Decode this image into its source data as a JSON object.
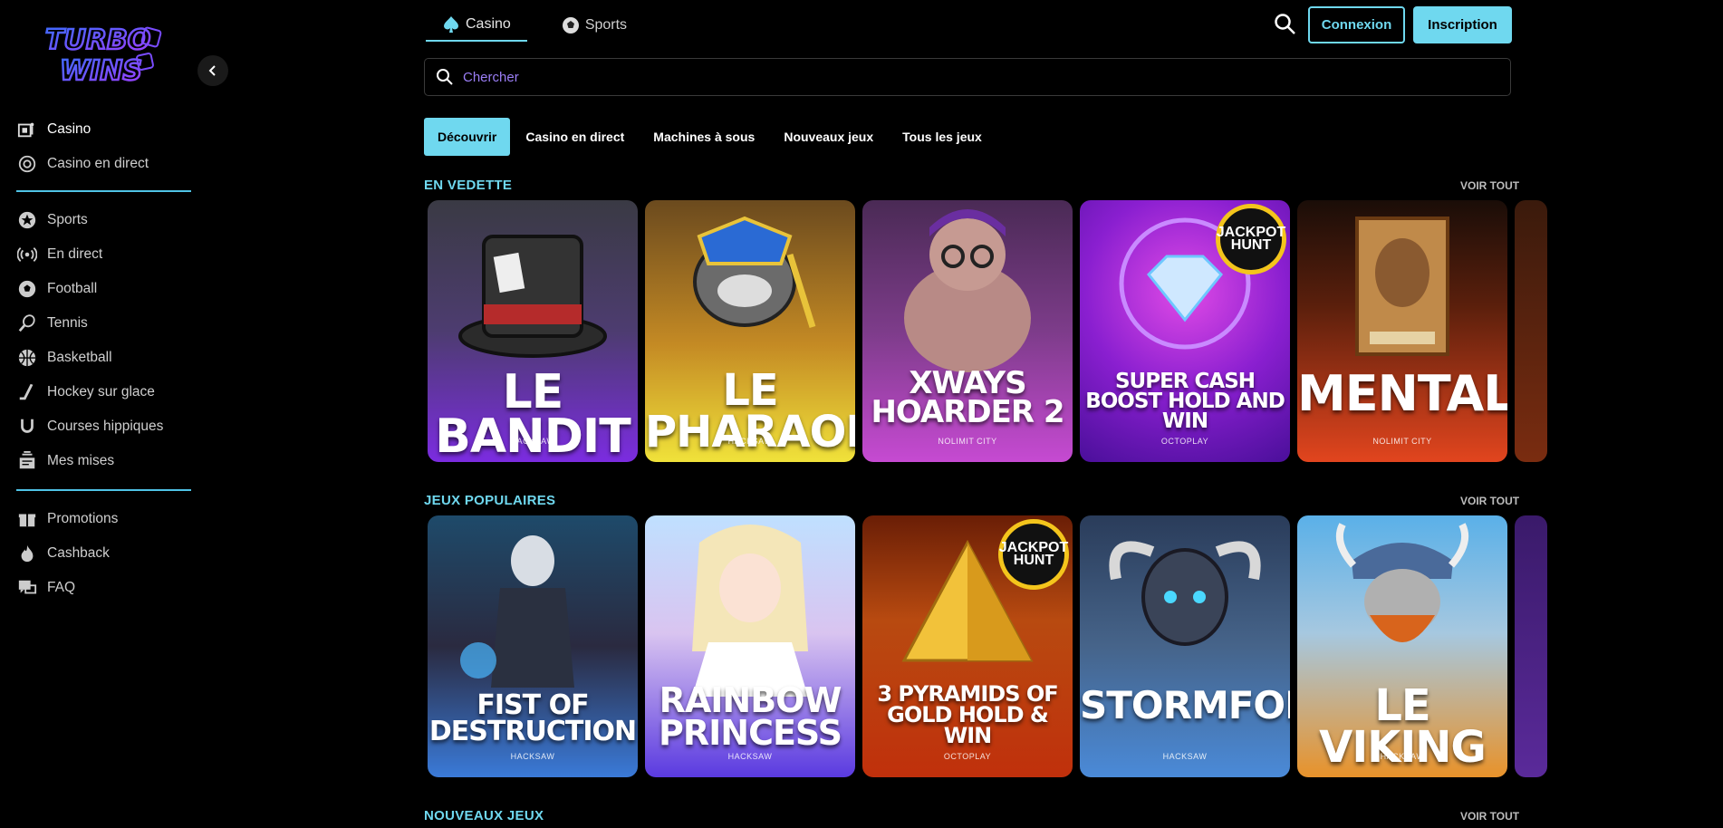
{
  "brand": {
    "logo_text_1": "TURBO",
    "logo_text_2": "WINS"
  },
  "sidebar": {
    "group1": [
      {
        "label": "Casino",
        "icon": "casino-icon",
        "active": true
      },
      {
        "label": "Casino en direct",
        "icon": "live-casino-icon"
      }
    ],
    "group2": [
      {
        "label": "Sports",
        "icon": "sports-icon"
      },
      {
        "label": "En direct",
        "icon": "live-broadcast-icon"
      },
      {
        "label": "Football",
        "icon": "football-icon"
      },
      {
        "label": "Tennis",
        "icon": "tennis-icon"
      },
      {
        "label": "Basketball",
        "icon": "basketball-icon"
      },
      {
        "label": "Hockey sur glace",
        "icon": "hockey-icon"
      },
      {
        "label": "Courses hippiques",
        "icon": "horseshoe-icon"
      },
      {
        "label": "Mes mises",
        "icon": "bets-icon"
      }
    ],
    "group3": [
      {
        "label": "Promotions",
        "icon": "gift-icon"
      },
      {
        "label": "Cashback",
        "icon": "fire-icon"
      },
      {
        "label": "FAQ",
        "icon": "faq-icon"
      }
    ]
  },
  "header": {
    "tabs": [
      {
        "label": "Casino",
        "icon": "spade-icon",
        "active": true
      },
      {
        "label": "Sports",
        "icon": "soccer-ball-icon"
      }
    ],
    "login_label": "Connexion",
    "signup_label": "Inscription"
  },
  "search": {
    "placeholder": "Chercher"
  },
  "categories": [
    "Découvrir",
    "Casino en direct",
    "Machines à sous",
    "Nouveaux jeux",
    "Tous les jeux"
  ],
  "sections": [
    {
      "title": "EN VEDETTE",
      "see_all": "VOIR TOUT",
      "games": [
        {
          "title": "LE BANDIT",
          "provider": "HACKSAW"
        },
        {
          "title": "LE PHARAOH",
          "provider": "HACKSAW"
        },
        {
          "title": "XWAYS HOARDER 2",
          "provider": "NOLIMIT CITY"
        },
        {
          "title": "SUPER CASH BOOST HOLD AND WIN",
          "provider": "OCTOPLAY",
          "badge": "JACKPOT HUNT"
        },
        {
          "title": "MENTAL",
          "provider": "NOLIMIT CITY"
        }
      ]
    },
    {
      "title": "JEUX POPULAIRES",
      "see_all": "VOIR TOUT",
      "games": [
        {
          "title": "FIST OF DESTRUCTION",
          "provider": "HACKSAW"
        },
        {
          "title": "RAINBOW PRINCESS",
          "provider": "HACKSAW"
        },
        {
          "title": "3 PYRAMIDS OF GOLD HOLD & WIN",
          "provider": "OCTOPLAY",
          "badge": "JACKPOT HUNT"
        },
        {
          "title": "STORMFORGED",
          "provider": "HACKSAW"
        },
        {
          "title": "LE VIKING",
          "provider": "HACKSAW"
        }
      ]
    },
    {
      "title": "NOUVEAUX JEUX",
      "see_all": "VOIR TOUT"
    }
  ],
  "colors": {
    "accent": "#6fd8ef",
    "placeholder": "#9b7ef6",
    "background": "#000000"
  }
}
